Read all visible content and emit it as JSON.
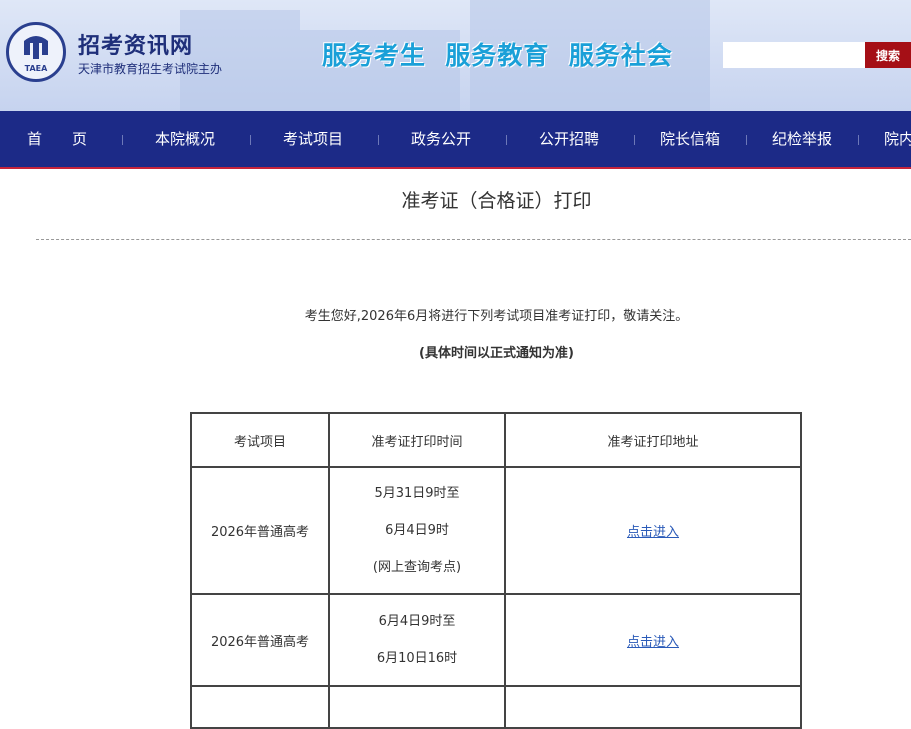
{
  "header": {
    "site_name": "招考资讯网",
    "site_sub": "天津市教育招生考试院主办",
    "logo_text": "TAEA",
    "slogan": "服务考生  服务教育  服务社会",
    "search": {
      "placeholder": "",
      "button": "搜索"
    }
  },
  "nav": [
    "首　　页",
    "本院概况",
    "考试项目",
    "政务公开",
    "公开招聘",
    "院长信箱",
    "纪检举报",
    "院内"
  ],
  "page": {
    "title": "准考证（合格证）打印",
    "notice": "考生您好,2026年6月将进行下列考试项目准考证打印，敬请关注。",
    "notice_bold": "(具体时间以正式通知为准)"
  },
  "table": {
    "headers": [
      "考试项目",
      "准考证打印时间",
      "准考证打印地址"
    ],
    "rows": [
      {
        "project": "2026年普通高考",
        "time": [
          "5月31日9时至",
          "6月4日9时",
          "(网上查询考点)"
        ],
        "link": "点击进入"
      },
      {
        "project": "2026年普通高考",
        "time": [
          "6月4日9时至",
          "6月10日16时"
        ],
        "link": "点击进入"
      }
    ]
  },
  "colors": {
    "nav_bg": "#1c2a87",
    "search_btn": "#a50f16",
    "slogan": "#1aa0d8"
  }
}
